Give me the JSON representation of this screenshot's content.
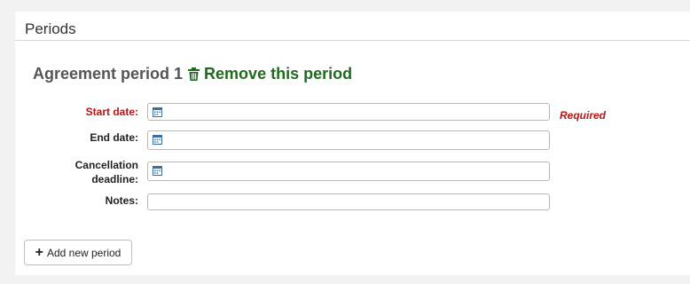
{
  "section": {
    "title": "Periods"
  },
  "period": {
    "heading": "Agreement period 1",
    "remove_label": "Remove this period"
  },
  "fields": {
    "start_date": {
      "label": "Start date:",
      "value": "",
      "required_text": "Required"
    },
    "end_date": {
      "label": "End date:",
      "value": ""
    },
    "cancellation_deadline": {
      "label_line1": "Cancellation",
      "label_line2": "deadline:",
      "value": ""
    },
    "notes": {
      "label": "Notes:",
      "value": ""
    }
  },
  "actions": {
    "add_period_label": "Add new period"
  },
  "colors": {
    "required": "#b41414",
    "link_green": "#1f6a1f"
  }
}
